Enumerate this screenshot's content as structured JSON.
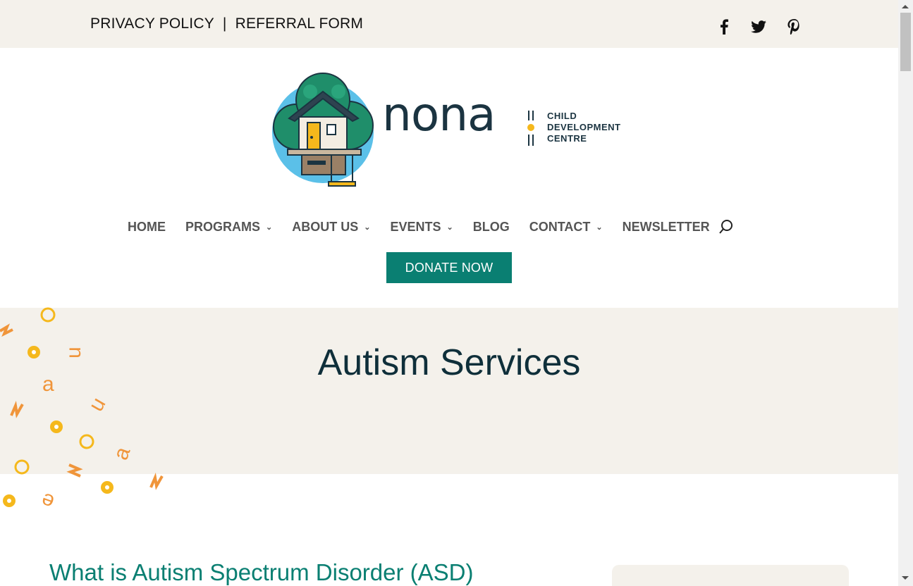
{
  "topbar": {
    "links": [
      "PRIVACY POLICY",
      "REFERRAL FORM"
    ],
    "separator": "|",
    "social": [
      "facebook-icon",
      "twitter-icon",
      "pinterest-icon"
    ]
  },
  "logo": {
    "wordmark": "nona",
    "subtitle": [
      "CHILD",
      "DEVELOPMENT",
      "CENTRE"
    ]
  },
  "nav": {
    "items": [
      {
        "label": "HOME",
        "dropdown": false
      },
      {
        "label": "PROGRAMS",
        "dropdown": true
      },
      {
        "label": "ABOUT US",
        "dropdown": true
      },
      {
        "label": "EVENTS",
        "dropdown": true
      },
      {
        "label": "BLOG",
        "dropdown": false
      },
      {
        "label": "CONTACT",
        "dropdown": true
      },
      {
        "label": "NEWSLETTER",
        "dropdown": false
      }
    ],
    "search_icon": "search-icon"
  },
  "donate": {
    "label": "DONATE NOW"
  },
  "hero": {
    "title": "Autism Services"
  },
  "main": {
    "section_title": "What is Autism Spectrum Disorder (ASD)"
  },
  "colors": {
    "accent": "#0a7f72",
    "beige": "#f4f1eb",
    "navy": "#1b3441",
    "yellow": "#f5b81c",
    "orange": "#f0953a"
  }
}
